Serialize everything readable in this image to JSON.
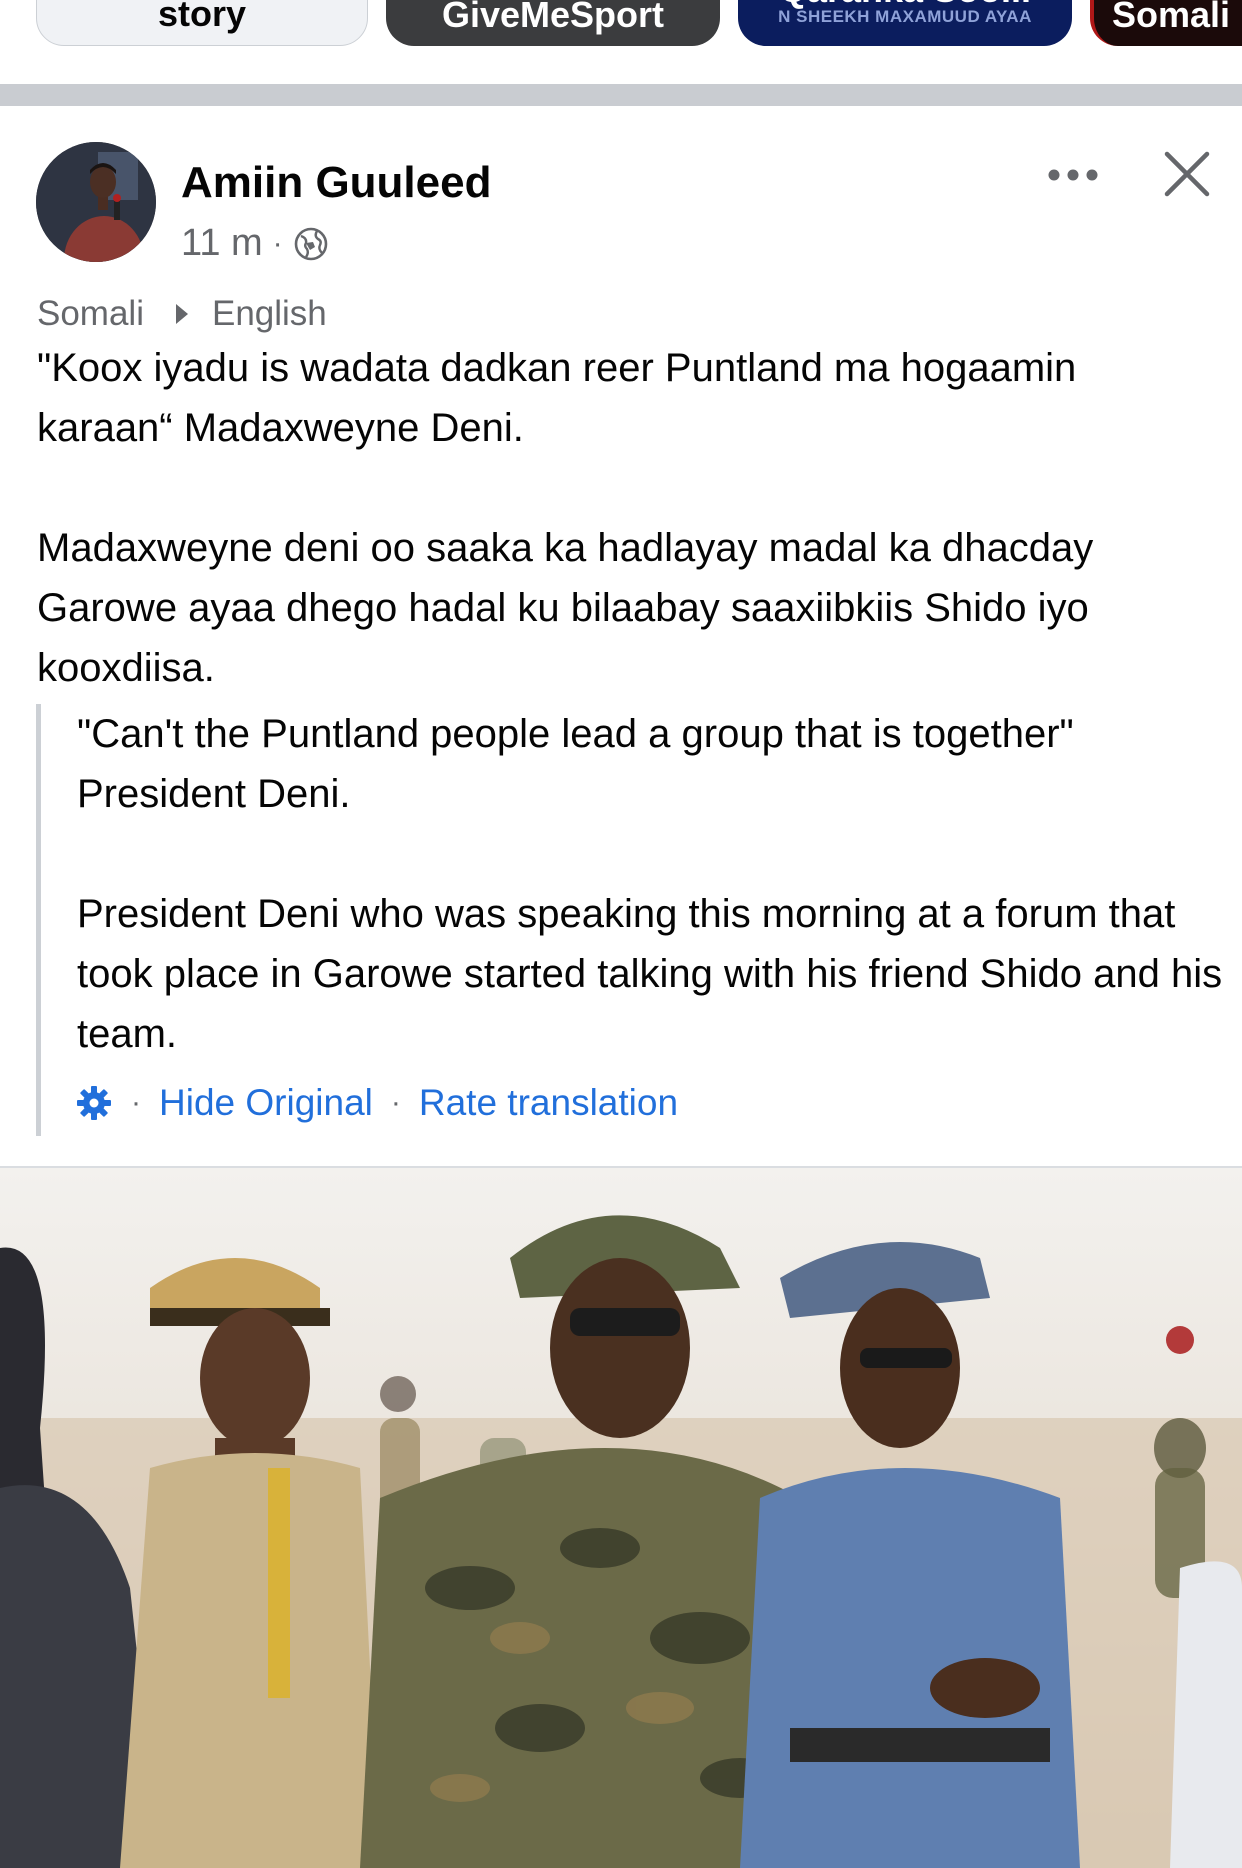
{
  "stories": [
    {
      "label": "story"
    },
    {
      "label": "GiveMeSport"
    },
    {
      "label": "Qaranka Soo...",
      "sub": "N SHEEKH MAXAMUUD AYAA"
    },
    {
      "label": "Somali"
    }
  ],
  "post": {
    "author": "Amiin Guuleed",
    "time": "11 m",
    "separator": "·",
    "audience_icon": "globe-icon",
    "more_icon": "more-options-icon",
    "close_icon": "close-icon",
    "translation": {
      "source_language": "Somali",
      "target_language": "English"
    },
    "original_text": {
      "line1": "\"Koox iyadu is wadata dadkan reer Puntland ma hogaamin karaan“ Madaxweyne Deni.",
      "line2": "Madaxweyne deni oo saaka ka hadlayay madal ka dhacday Garowe ayaa dhego hadal ku bilaabay saaxiibkiis Shido iyo kooxdiisa."
    },
    "translated_text": {
      "line1": "\"Can't the Puntland people lead a group that is together\" President Deni.",
      "line2": "President Deni who was speaking this morning at a forum that took place in Garowe started talking with his friend Shido and his team."
    },
    "actions": {
      "settings_icon": "gear-icon",
      "hide_original": "Hide Original",
      "rate_translation": "Rate translation",
      "separator": "·"
    }
  },
  "colors": {
    "link": "#216fdb",
    "secondary_text": "#65676b",
    "primary_text": "#050505",
    "divider": "#c9ccd1"
  }
}
